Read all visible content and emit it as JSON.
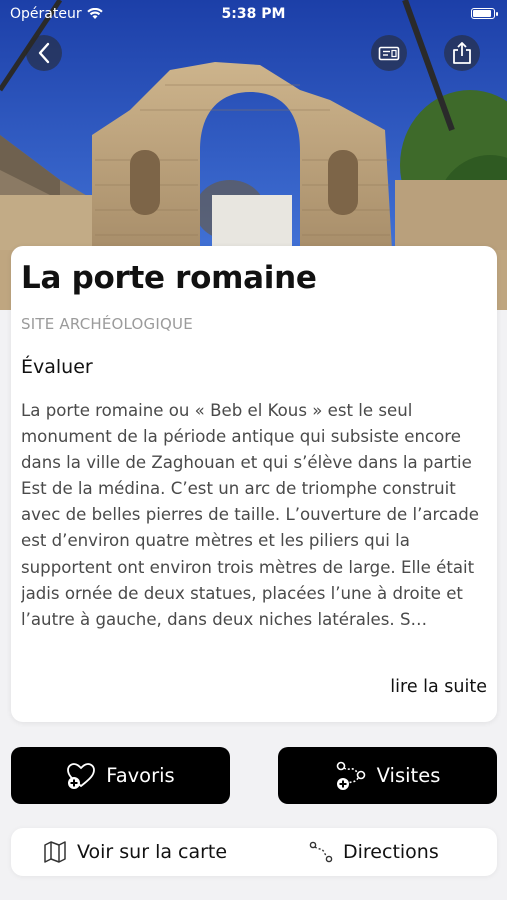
{
  "status_bar": {
    "carrier": "Opérateur",
    "time": "5:38 PM"
  },
  "hero": {
    "icons": [
      "back-icon",
      "ticket-icon",
      "share-icon"
    ]
  },
  "place": {
    "title": "La porte romaine",
    "category": "SITE ARCHÉOLOGIQUE",
    "rate_label": "Évaluer",
    "description": "La porte romaine ou « Beb el Kous » est le seul monument de la période antique qui subsiste encore dans la ville de Zaghouan et qui s’élève dans la partie Est de la médina. C’est un arc de triomphe construit avec de belles pierres de taille. L’ouverture de l’arcade est d’environ quatre mètres et les piliers qui la supportent ont environ trois mètres de large. Elle était jadis ornée de deux statues, placées l’une à droite et l’autre à gauche, dans deux niches latérales. S…",
    "read_more": "lire la suite"
  },
  "actions": {
    "favorites_label": "Favoris",
    "visits_label": "Visites"
  },
  "bottom_bar": {
    "map_label": "Voir sur la carte",
    "directions_label": "Directions"
  },
  "colors": {
    "button_bg": "#000000",
    "category": "#9b9b9b",
    "page_bg": "#f2f2f4"
  }
}
